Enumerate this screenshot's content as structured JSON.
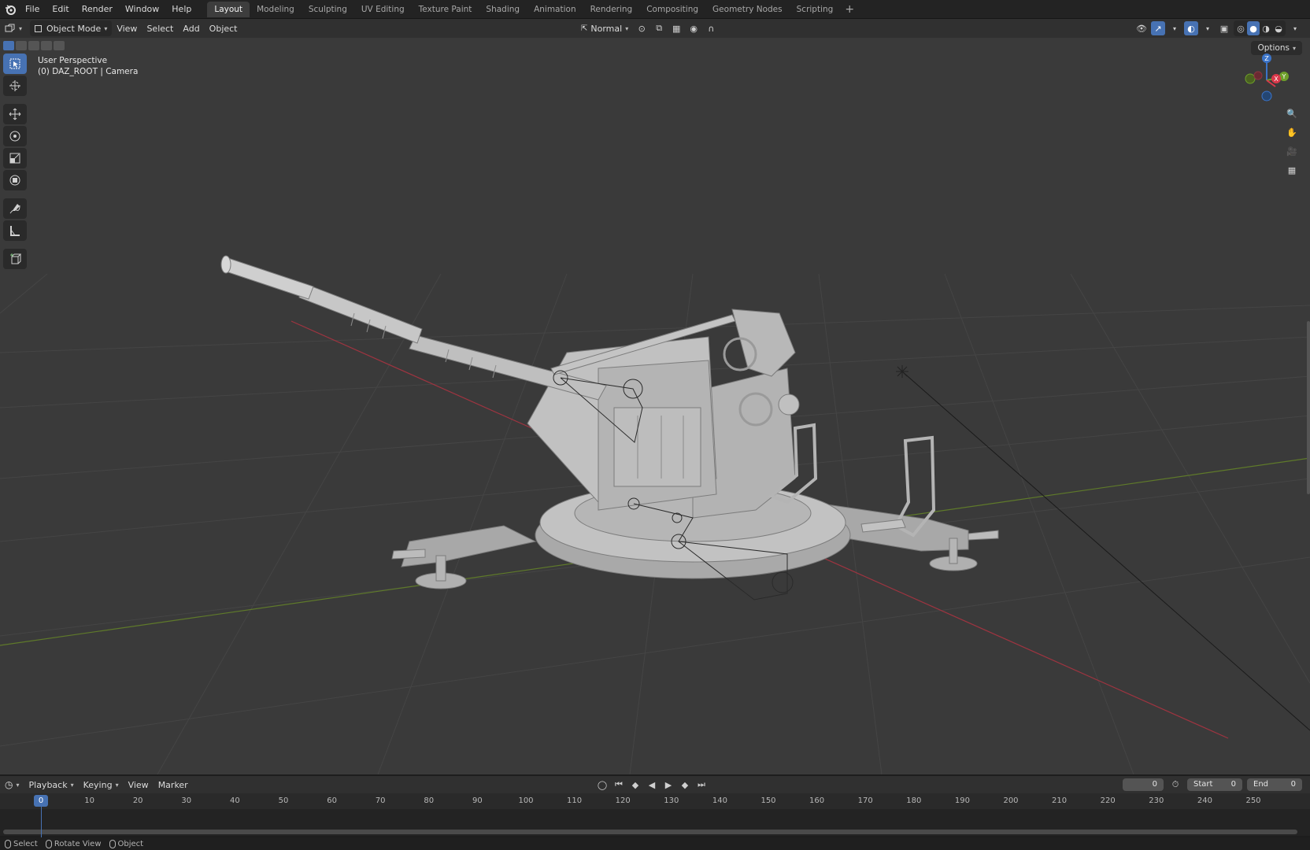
{
  "menubar": {
    "items": [
      "File",
      "Edit",
      "Render",
      "Window",
      "Help"
    ],
    "workspaces": [
      "Layout",
      "Modeling",
      "Sculpting",
      "UV Editing",
      "Texture Paint",
      "Shading",
      "Animation",
      "Rendering",
      "Compositing",
      "Geometry Nodes",
      "Scripting"
    ],
    "active_workspace": "Layout",
    "add_symbol": "+"
  },
  "viewport_header": {
    "mode": "Object Mode",
    "menus": [
      "View",
      "Select",
      "Add",
      "Object"
    ],
    "orientation": "Normal",
    "options_label": "Options"
  },
  "viewport": {
    "perspective_label": "User Perspective",
    "active_object_label": "(0) DAZ_ROOT | Camera",
    "gizmo_axes": {
      "x": "X",
      "y": "Y",
      "z": "Z"
    },
    "colors": {
      "background": "#3a3a3a",
      "grid": "#474747",
      "x_axis": "#a3313d",
      "y_axis": "#6b8a2b",
      "model": "#bdbdbd"
    }
  },
  "timeline": {
    "menus": [
      "Playback",
      "Keying",
      "View",
      "Marker"
    ],
    "current_frame": "0",
    "start_label": "Start",
    "start_value": "0",
    "end_label": "End",
    "end_value": "0",
    "ticks": [
      "0",
      "10",
      "20",
      "30",
      "40",
      "50",
      "60",
      "70",
      "80",
      "90",
      "100",
      "110",
      "120",
      "130",
      "140",
      "150",
      "160",
      "170",
      "180",
      "190",
      "200",
      "210",
      "220",
      "230",
      "240",
      "250"
    ]
  },
  "statusbar": {
    "items": [
      "Select",
      "Rotate View",
      "Object"
    ]
  },
  "accent_color": "#4772b3"
}
